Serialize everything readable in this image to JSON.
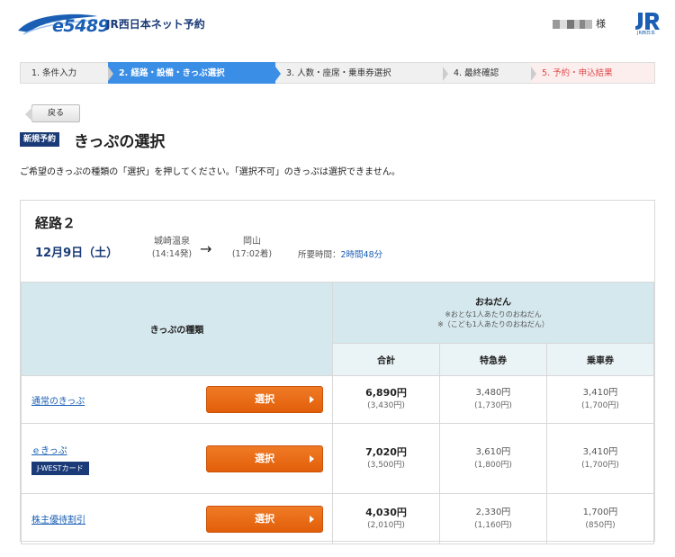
{
  "header": {
    "logo_text": "e5489",
    "brand": "JR西日本ネット予約",
    "user_suffix": "様",
    "jr_logo_text": "JR西日本"
  },
  "steps": [
    {
      "label": "1. 条件入力"
    },
    {
      "label": "2. 経路・設備・きっぷ選択"
    },
    {
      "label": "3. 人数・座席・乗車券選択"
    },
    {
      "label": "4. 最終確認"
    },
    {
      "label": "5. 予約・申込結果"
    }
  ],
  "back_label": "戻る",
  "badge_label": "新規予約",
  "page_title": "きっぷの選択",
  "instruction": "ご希望のきっぷの種類の「選択」を押してください。「選択不可」のきっぷは選択できません。",
  "route": {
    "title": "経路２",
    "date": "12月9日（土）",
    "from_station": "城崎温泉",
    "from_time": "(14:14発)",
    "to_station": "岡山",
    "to_time": "(17:02着)",
    "arrow": "→",
    "duration_label": "所要時間：",
    "duration_value": "2時間48分"
  },
  "table": {
    "type_header": "きっぷの種類",
    "price_header": "おねだん",
    "price_note1": "※おとな1人あたりのおねだん",
    "price_note2": "※（こども1人あたりのおねだん）",
    "col_total": "合計",
    "col_express": "特急券",
    "col_fare": "乗車券",
    "select_label": "選択",
    "rows": [
      {
        "name": "通常のきっぷ",
        "badge": "",
        "total": "6,890円",
        "total_child": "(3,430円)",
        "express": "3,480円",
        "express_child": "(1,730円)",
        "fare": "3,410円",
        "fare_child": "(1,700円)"
      },
      {
        "name": "ｅきっぷ",
        "badge": "J-WESTカード",
        "total": "7,020円",
        "total_child": "(3,500円)",
        "express": "3,610円",
        "express_child": "(1,800円)",
        "fare": "3,410円",
        "fare_child": "(1,700円)"
      },
      {
        "name": "株主優待割引",
        "badge": "",
        "total": "4,030円",
        "total_child": "(2,010円)",
        "express": "2,330円",
        "express_child": "(1,160円)",
        "fare": "1,700円",
        "fare_child": "(850円)"
      }
    ]
  },
  "colors": {
    "accent": "#3a8ee6",
    "navy": "#1a3b78",
    "select": "#e8690f",
    "header_bg": "#d5e8ee"
  }
}
